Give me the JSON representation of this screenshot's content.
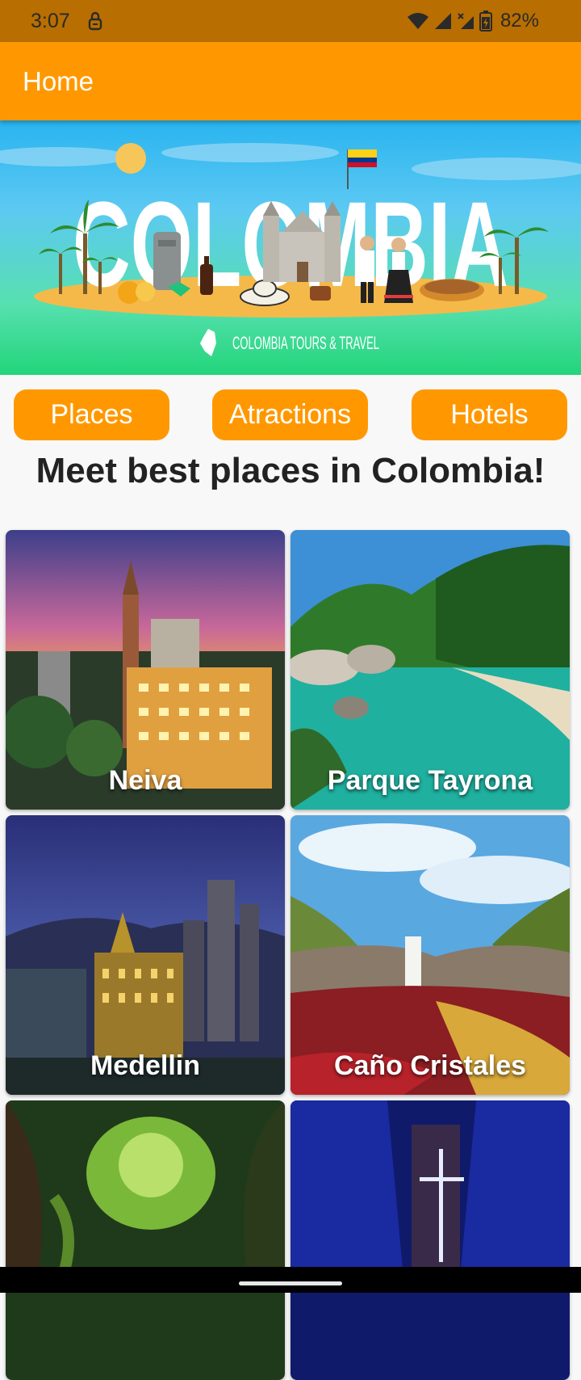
{
  "status_bar": {
    "time": "3:07",
    "battery": "82%",
    "icons": [
      "lock-icon",
      "wifi-icon",
      "signal-icon",
      "signal-off-icon",
      "battery-charging-icon"
    ]
  },
  "app_bar": {
    "title": "Home"
  },
  "banner": {
    "title": "COLOMBIA",
    "brand": "COLOMBIA TOURS & TRAVEL"
  },
  "tabs": [
    {
      "label": "Places"
    },
    {
      "label": "Atractions"
    },
    {
      "label": "Hotels"
    }
  ],
  "headline": "Meet best places in Colombia!",
  "places": [
    {
      "name": "Neiva"
    },
    {
      "name": "Parque Tayrona"
    },
    {
      "name": "Medellin"
    },
    {
      "name": "Caño Cristales"
    },
    {
      "name": ""
    },
    {
      "name": ""
    }
  ],
  "colors": {
    "accent": "#ff9800",
    "status_bar": "#b86e00",
    "button_text": "#ffffff",
    "headline": "#222222"
  }
}
